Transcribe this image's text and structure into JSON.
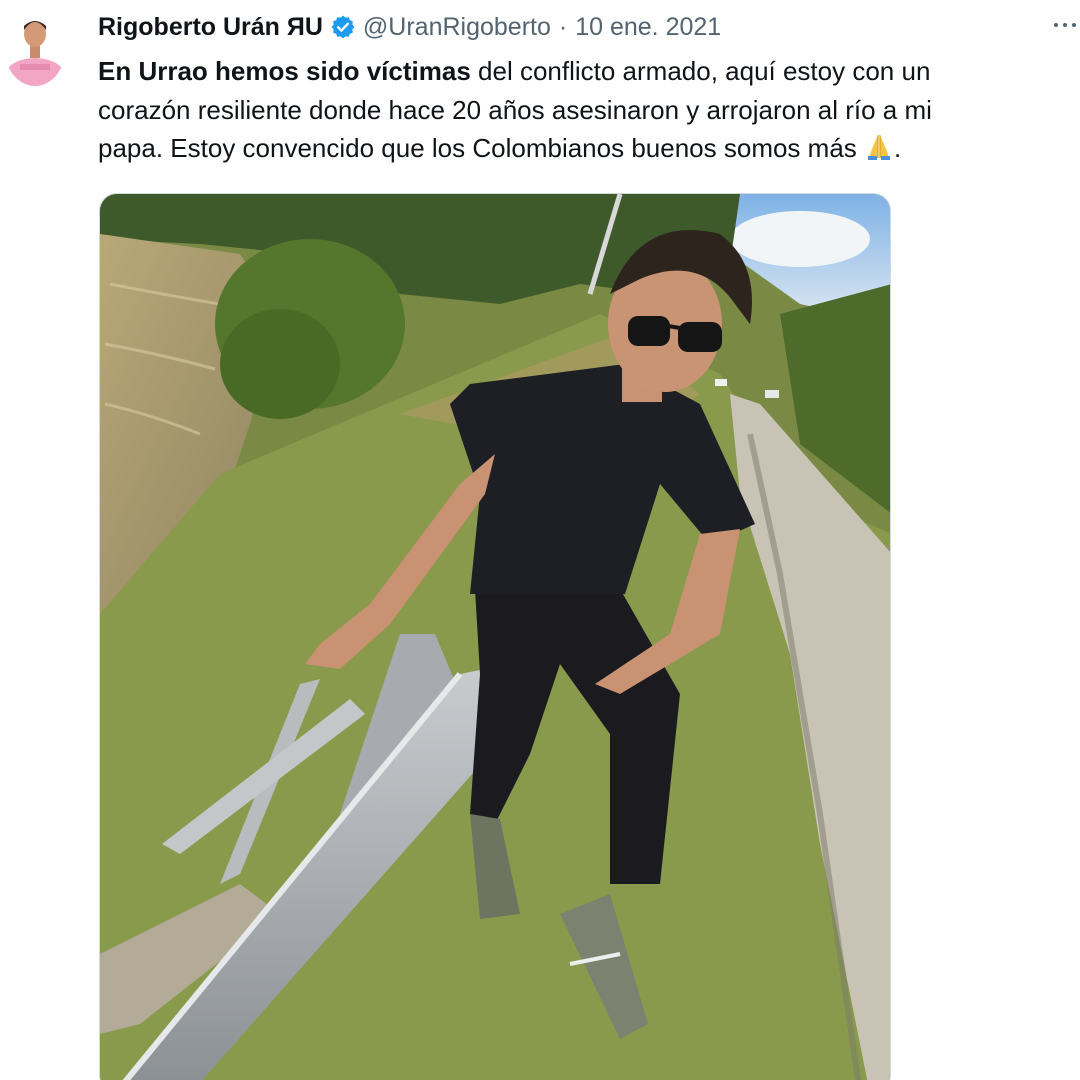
{
  "tweet": {
    "display_name": "Rigoberto Urán ЯU",
    "handle": "@UranRigoberto",
    "separator": "·",
    "timestamp": "10 ene. 2021",
    "text": {
      "bold": "En Urrao hemos sido víctimas",
      "line1_rest": " del conflicto armado, aquí estoy con un",
      "line2": "corazón resiliente  donde hace 20 años asesinaron y arrojaron al río a mi",
      "line3": "papa. Estoy convencido que los Colombianos buenos somos más ",
      "line3_end": "."
    },
    "icons": {
      "verified": "verified-badge-icon",
      "more": "more-options-icon",
      "emoji": "folded-hands-emoji"
    },
    "media": {
      "type": "photo"
    }
  },
  "colors": {
    "text_primary": "#0f1419",
    "text_secondary": "#536471",
    "verified_blue": "#1d9bf0",
    "avatar_jersey": "#f2a6c4"
  }
}
